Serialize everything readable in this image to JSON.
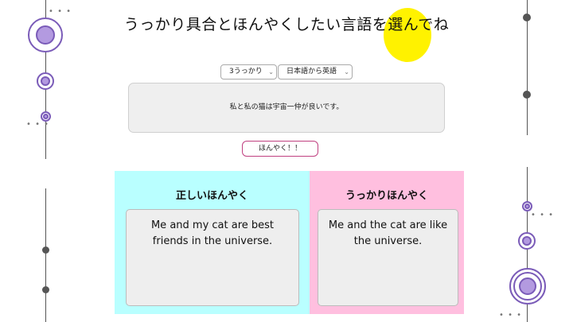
{
  "header": {
    "title": "うっかり具合とほんやくしたい言語を選んでね"
  },
  "controls": {
    "mistake_level": {
      "selected": "3うっかり"
    },
    "language_pair": {
      "selected": "日本語から英語"
    },
    "source_text": "私と私の猫は宇宙一仲が良いです。",
    "translate_button": "ほんやく！！"
  },
  "results": {
    "correct": {
      "heading": "正しいほんやく",
      "text": "Me and my cat are best friends in the universe."
    },
    "careless": {
      "heading": "うっかりほんやく",
      "text": "Me and the cat are like the universe."
    }
  },
  "decor": {
    "dots": "• • •",
    "colors": {
      "accent_purple": "#7a5bb8",
      "yellow": "#fff200",
      "cyan_panel": "#b9ffff",
      "pink_panel": "#ffbfdf",
      "button_border": "#c04080"
    }
  }
}
